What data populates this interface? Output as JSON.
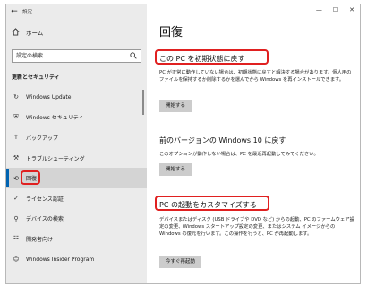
{
  "window": {
    "title": "設定",
    "back_glyph": "←",
    "controls": {
      "minimize": "—",
      "maximize": "☐",
      "close": "✕"
    }
  },
  "sidebar": {
    "home_label": "ホーム",
    "search_placeholder": "設定の検索",
    "section_label": "更新とセキュリティ",
    "items": [
      {
        "label": "Windows Update",
        "icon": "refresh-icon",
        "glyph": "↻"
      },
      {
        "label": "Windows セキュリティ",
        "icon": "shield-icon",
        "glyph": "⛨"
      },
      {
        "label": "バックアップ",
        "icon": "upload-icon",
        "glyph": "↑"
      },
      {
        "label": "トラブルシューティング",
        "icon": "wrench-icon",
        "glyph": "⚒"
      },
      {
        "label": "回復",
        "icon": "history-icon",
        "glyph": "⟲",
        "selected": true
      },
      {
        "label": "ライセンス認証",
        "icon": "check-circle-icon",
        "glyph": "✓"
      },
      {
        "label": "デバイスの検索",
        "icon": "person-pin-icon",
        "glyph": "⚲"
      },
      {
        "label": "開発者向け",
        "icon": "developer-icon",
        "glyph": "☷"
      },
      {
        "label": "Windows Insider Program",
        "icon": "insider-icon",
        "glyph": "☺"
      }
    ]
  },
  "main": {
    "title": "回復",
    "sections": [
      {
        "heading": "この PC を初期状態に戻す",
        "text": "PC が正常に動作していない場合は、初期状態に戻すと解決する場合があります。個人用のファイルを保持するか削除するかを選んでから Windows を再インストールできます。",
        "button": "開始する"
      },
      {
        "heading": "前のバージョンの Windows 10 に戻す",
        "text": "このオプションが動作しない場合は、PC を最近再起動してみてください。",
        "button": "開始する"
      },
      {
        "heading": "PC の起動をカスタマイズする",
        "text": "デバイスまたはディスク (USB ドライブや DVD など) からの起動、PC のファームウェア設定の変更、Windows スタートアップ設定の変更、またはシステム イメージからの Windows の復元を行います。この操作を行うと、PC が再起動します。",
        "button": "今すぐ再起動"
      }
    ]
  },
  "colors": {
    "highlight_box": "#e02020",
    "selection_bar": "#0063b1",
    "sidebar_bg": "#ebebeb",
    "button_bg": "#cccccc"
  }
}
